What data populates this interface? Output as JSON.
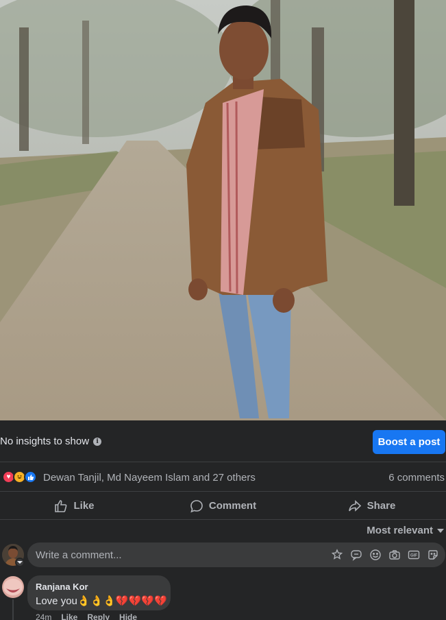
{
  "insights": {
    "text": "No insights to show",
    "boost_label": "Boost a post"
  },
  "reactions": {
    "icons": [
      "love",
      "haha",
      "like"
    ],
    "names": "Dewan Tanjil, Md Nayeem Islam and 27 others",
    "comments_count": "6 comments"
  },
  "actions": {
    "like": "Like",
    "comment": "Comment",
    "share": "Share"
  },
  "sort": {
    "label": "Most relevant"
  },
  "composer": {
    "placeholder": "Write a comment..."
  },
  "comment": {
    "author": "Ranjana Kor",
    "text": "Love you👌👌👌💔💔💔💔",
    "time": "24m",
    "like": "Like",
    "reply": "Reply",
    "hide": "Hide"
  },
  "colors": {
    "background": "#242526",
    "accent": "#1877f2",
    "bubble": "#3a3b3c"
  }
}
